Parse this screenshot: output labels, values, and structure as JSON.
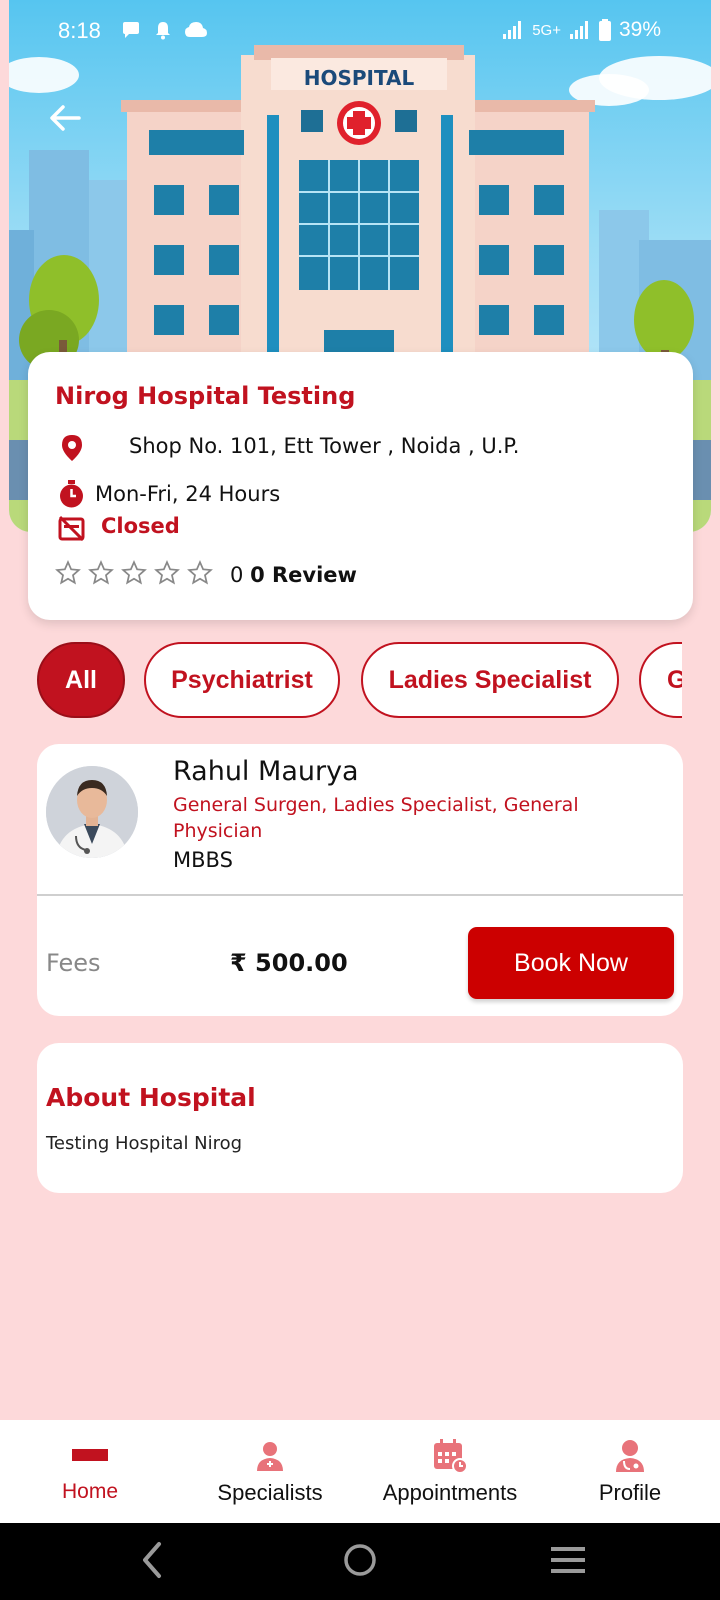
{
  "status_bar": {
    "time": "8:18",
    "network": "5G+",
    "battery": "39%"
  },
  "hero": {
    "sign": "HOSPITAL"
  },
  "hospital": {
    "name": "Nirog Hospital Testing",
    "address": "Shop No. 101, Ett Tower , Noida , U.P.",
    "hours": "Mon-Fri, 24 Hours",
    "status": "Closed",
    "rating_value": "0",
    "review_text": "0 Review",
    "stars_filled": 0,
    "stars_total": 5
  },
  "filters": {
    "chips": [
      "All",
      "Psychiatrist",
      "Ladies Specialist",
      "G"
    ],
    "selected": "All"
  },
  "doctor": {
    "name": "Rahul Maurya",
    "specialities": "General Surgen, Ladies Specialist, General Physician",
    "degree": "MBBS",
    "fees_label": "Fees",
    "fees_value": "₹ 500.00",
    "book_label": "Book Now"
  },
  "about": {
    "title": "About Hospital",
    "text": "Testing Hospital Nirog"
  },
  "bottom_nav": {
    "items": [
      {
        "label": "Home",
        "icon": "home-icon"
      },
      {
        "label": "Specialists",
        "icon": "specialist-icon"
      },
      {
        "label": "Appointments",
        "icon": "calendar-icon"
      },
      {
        "label": "Profile",
        "icon": "profile-icon"
      }
    ],
    "active": "Home"
  },
  "colors": {
    "accent": "#c1121f",
    "background": "#fdd9da",
    "button": "#cc0000"
  }
}
